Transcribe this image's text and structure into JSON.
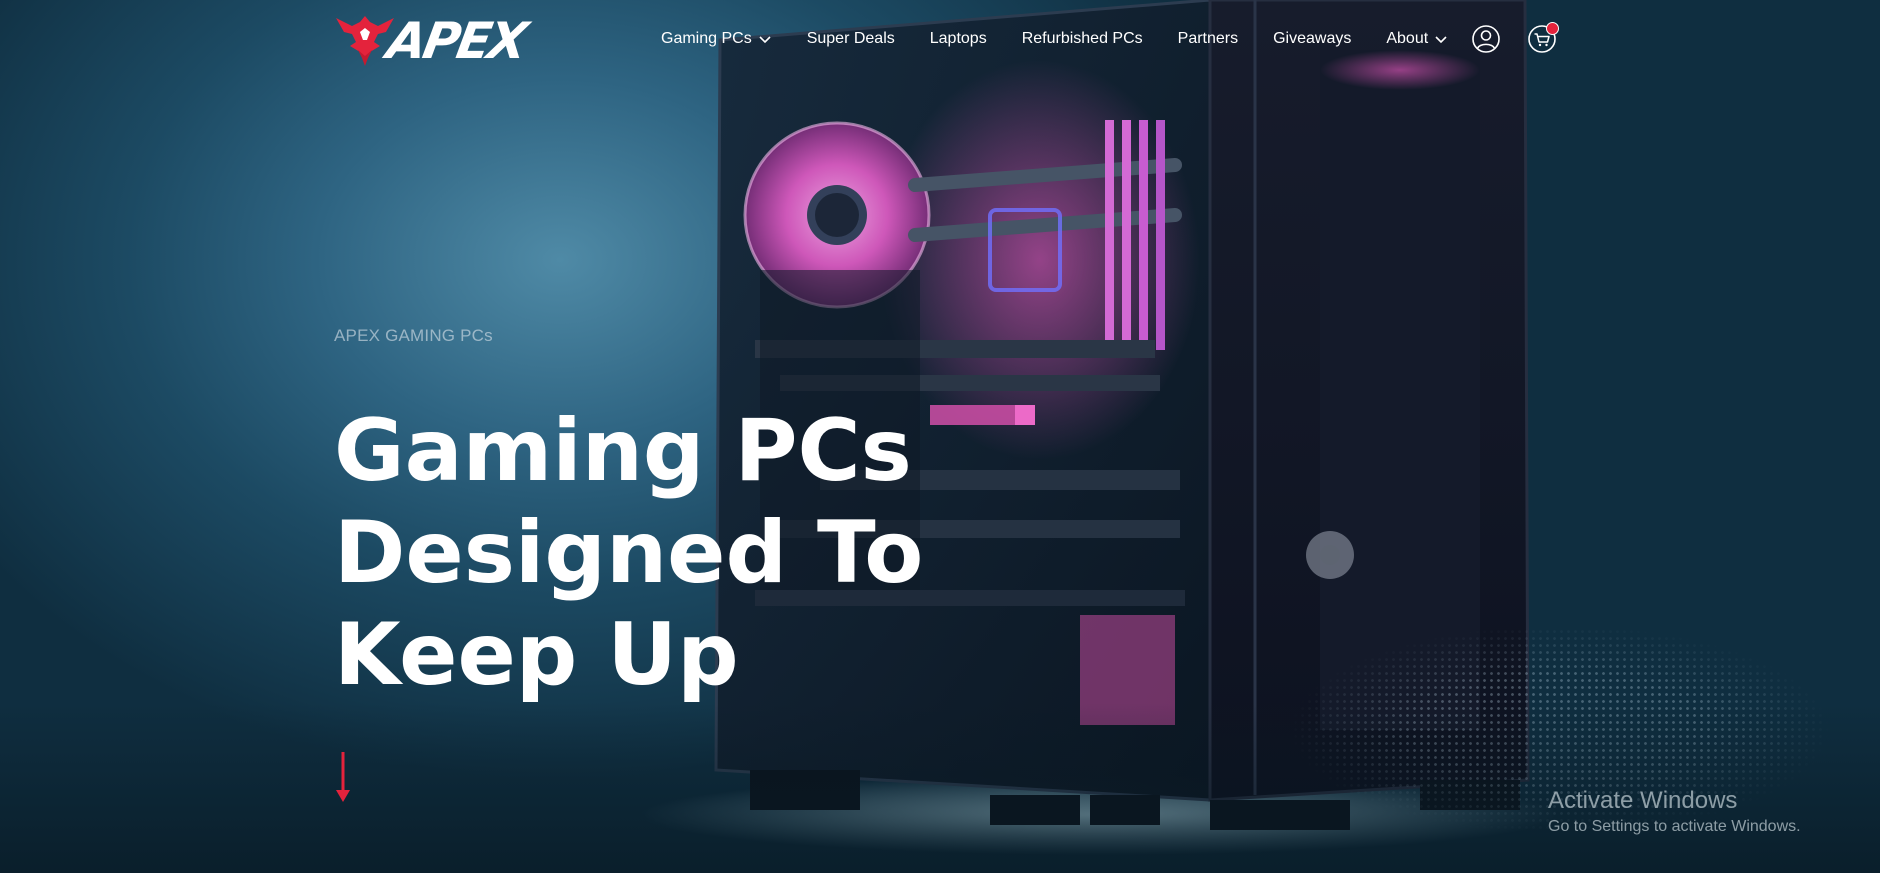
{
  "brand": {
    "name": "APEX",
    "accent_color": "#e4233c"
  },
  "nav": {
    "items": [
      {
        "label": "Gaming PCs",
        "has_dropdown": true
      },
      {
        "label": "Super Deals",
        "has_dropdown": false
      },
      {
        "label": "Laptops",
        "has_dropdown": false
      },
      {
        "label": "Refurbished PCs",
        "has_dropdown": false
      },
      {
        "label": "Partners",
        "has_dropdown": false
      },
      {
        "label": "Giveaways",
        "has_dropdown": false
      },
      {
        "label": "About",
        "has_dropdown": true
      }
    ],
    "icons": [
      "user-account-icon",
      "shopping-cart-icon"
    ],
    "cart_has_badge": true
  },
  "hero": {
    "eyebrow": "APEX GAMING PCs",
    "headline_lines": [
      "Gaming PCs",
      "Designed To",
      "Keep Up"
    ],
    "scroll_icon": "arrow-down-icon"
  },
  "watermark": {
    "title": "Activate Windows",
    "subtitle": "Go to Settings to activate Windows."
  }
}
